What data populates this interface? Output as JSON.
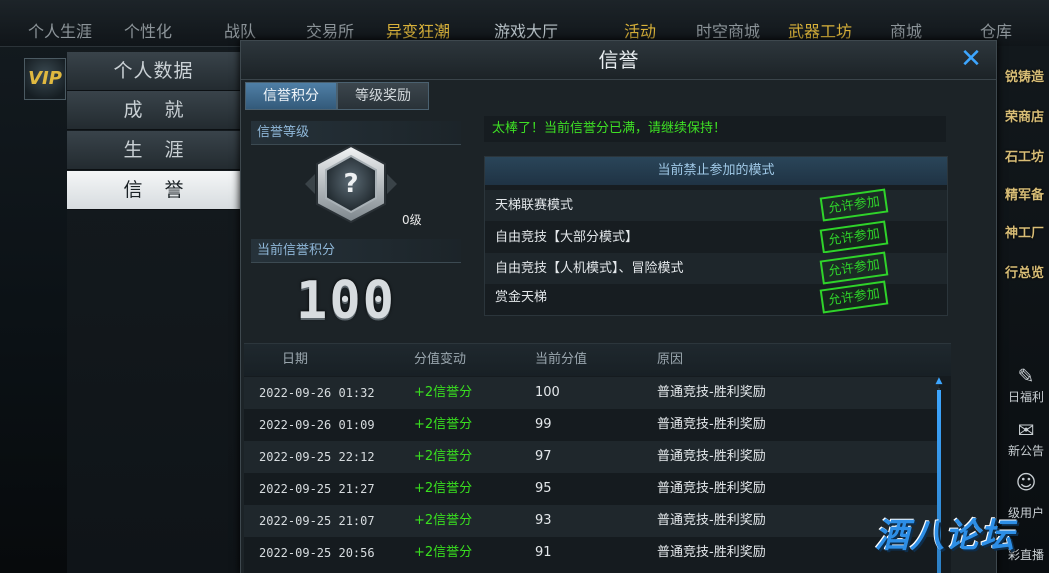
{
  "topnav": {
    "tabs": [
      "个人生涯",
      "个性化",
      "战队",
      "交易所",
      "异变狂潮",
      "游戏大厅",
      "活动",
      "时空商城",
      "武器工坊",
      "商城",
      "仓库"
    ]
  },
  "vip": {
    "label": "VIP"
  },
  "left_menu": {
    "items": [
      {
        "label": "个人数据"
      },
      {
        "label": "成就"
      },
      {
        "label": "生涯"
      },
      {
        "label": "信誉"
      }
    ]
  },
  "right_strip": {
    "items": [
      "锐铸造",
      "荣商店",
      "石工坊",
      "精军备",
      "神工厂",
      "行总览"
    ],
    "small": [
      "日福利",
      "新公告",
      "级用户",
      "彩直播"
    ]
  },
  "dialog": {
    "title": "信誉",
    "tabs": [
      {
        "label": "信誉积分"
      },
      {
        "label": "等级奖励"
      }
    ],
    "credit_level_header": "信誉等级",
    "level_label": "0级",
    "badge_symbol": "?",
    "current_score_header": "当前信誉积分",
    "current_score": "100",
    "status_message": "太棒了！当前信誉分已满，请继续保持！",
    "ban_header": "当前禁止参加的模式",
    "modes": [
      {
        "name": "天梯联赛模式",
        "stamp": "允许参加"
      },
      {
        "name": "自由竞技【大部分模式】",
        "stamp": "允许参加"
      },
      {
        "name": "自由竞技【人机模式】、冒险模式",
        "stamp": "允许参加"
      },
      {
        "name": "赏金天梯",
        "stamp": "允许参加"
      }
    ],
    "table": {
      "headers": [
        "日期",
        "分值变动",
        "当前分值",
        "原因"
      ],
      "rows": [
        {
          "date": "2022-09-26 01:32",
          "change": "+2信誉分",
          "score": "100",
          "reason": "普通竞技-胜利奖励"
        },
        {
          "date": "2022-09-26 01:09",
          "change": "+2信誉分",
          "score": "99",
          "reason": "普通竞技-胜利奖励"
        },
        {
          "date": "2022-09-25 22:12",
          "change": "+2信誉分",
          "score": "97",
          "reason": "普通竞技-胜利奖励"
        },
        {
          "date": "2022-09-25 21:27",
          "change": "+2信誉分",
          "score": "95",
          "reason": "普通竞技-胜利奖励"
        },
        {
          "date": "2022-09-25 21:07",
          "change": "+2信誉分",
          "score": "93",
          "reason": "普通竞技-胜利奖励"
        },
        {
          "date": "2022-09-25 20:56",
          "change": "+2信誉分",
          "score": "91",
          "reason": "普通竞技-胜利奖励"
        }
      ]
    }
  },
  "watermark": "酒八论坛",
  "colors": {
    "accent_blue": "#3da6ff",
    "positive_green": "#39e01f",
    "gold": "#d9b23a"
  }
}
